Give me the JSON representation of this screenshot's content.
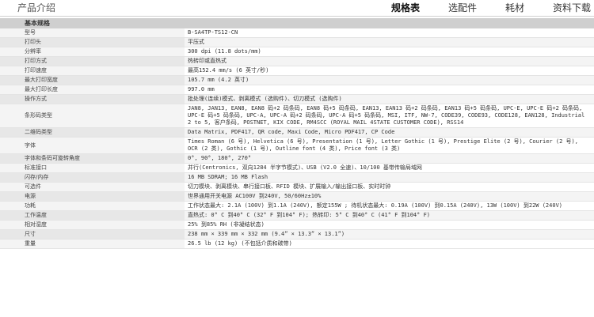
{
  "header": {
    "title": "产品介绍",
    "tabs": [
      {
        "label": "规格表",
        "active": true
      },
      {
        "label": "选配件",
        "active": false
      },
      {
        "label": "耗材",
        "active": false
      },
      {
        "label": "资料下载",
        "active": false
      }
    ]
  },
  "section_title": "基本规格",
  "specs": [
    {
      "k": "型号",
      "v": "B-SA4TP-TS12-CN"
    },
    {
      "k": "打印头",
      "v": "平压式"
    },
    {
      "k": "分辨率",
      "v": "300 dpi (11.8 dots/mm)"
    },
    {
      "k": "打印方式",
      "v": "热转印或直热式"
    },
    {
      "k": "打印速度",
      "v": "最高152.4 mm/s (6 英寸/秒)"
    },
    {
      "k": "最大打印宽度",
      "v": "105.7 mm (4.2 英寸)"
    },
    {
      "k": "最大打印长度",
      "v": "997.0 mm"
    },
    {
      "k": "操作方式",
      "v": "批处理(连续)模式、剥离模式 (选购件)、切刀模式 (选购件)"
    },
    {
      "k": "条形码类型",
      "v": "JAN8, JAN13, EAN8, EAN8 码+2 码条码, EAN8 码+5 码条码, EAN13, EAN13 码+2 码条码, EAN13 码+5 码条码, UPC-E, UPC-E 码+2 码条码, UPC-E 码+5 码条码, UPC-A, UPC-A 码+2 码条码, UPC-A 码+5 码条码, MSI, ITF, NW-7, CODE39, CODE93, CODE128, EAN128, Industrial 2 to 5, 客户条码, POSTNET, KIX CODE, RM4SCC (ROYAL MAIL 4STATE CUSTOMER CODE), RSS14"
    },
    {
      "k": "二维码类型",
      "v": "Data Matrix, PDF417, QR code, Maxi Code, Micro PDF417, CP Code"
    },
    {
      "k": "字体",
      "v": "Times Roman (6 号), Helvetica (6 号), Presentation (1 号), Letter Gothic (1 号), Prestige Elite (2 号), Courier (2 号), OCR (2 类), Gothic (1 号), Outline font (4 类), Price font (3 类)"
    },
    {
      "k": "字体和条码可旋转角度",
      "v": "0°, 90°, 180°, 270°"
    },
    {
      "k": "标准接口",
      "v": "并行(Centronics, 双向1284 半字节模式)、USB (V2.0 全速)、10/100 基带传输局域网"
    },
    {
      "k": "闪存/内存",
      "v": "16 MB SDRAM; 16 MB Flash"
    },
    {
      "k": "可选件",
      "v": "切刀模块、剥离模块、串行接口板、RFID 模块、扩展输入/输出接口板、实时时钟"
    },
    {
      "k": "电源",
      "v": "世界通用开关电源 AC100V 到240V, 50/60Hz±10%"
    },
    {
      "k": "功耗",
      "v": "工作状态最大: 2.1A (100V) 到1.1A (240V), 额定155W ; 待机状态最大: 0.19A (100V) 到0.15A (240V), 13W (100V) 到22W (240V)"
    },
    {
      "k": "工作温度",
      "v": "直热式: 0° C 到40° C (32° F 到104° F); 热转印: 5° C 到40° C (41° F 到104° F)"
    },
    {
      "k": "相对湿度",
      "v": "25% 到85% RH (非凝结状态)"
    },
    {
      "k": "尺寸",
      "v": "238 mm × 339 mm × 332 mm (9.4” × 13.3” × 13.1”)"
    },
    {
      "k": "重量",
      "v": "26.5 lb (12 kg) (不包括介质和碳带)"
    }
  ]
}
